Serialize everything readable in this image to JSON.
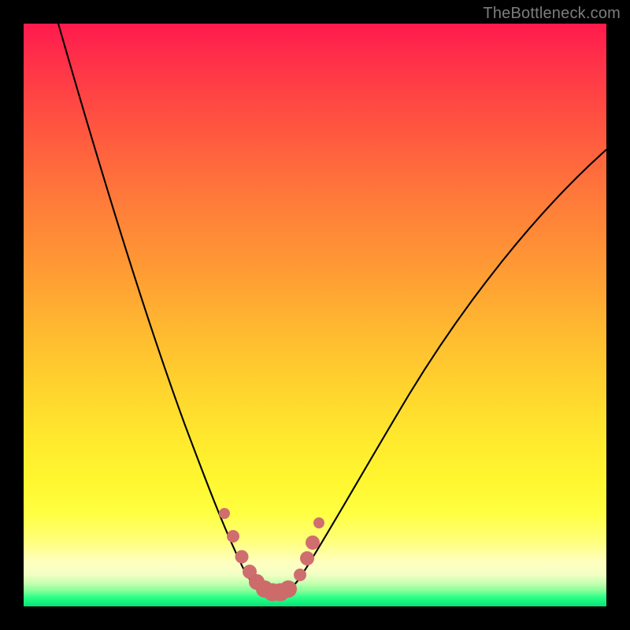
{
  "watermark": "TheBottleneck.com",
  "colors": {
    "gradient_top": "#ff1a4d",
    "gradient_mid": "#ffe62e",
    "gradient_bottom": "#00e676",
    "curve": "#000000",
    "markers": "#cf6e6e",
    "frame": "#000000"
  },
  "chart_data": {
    "type": "line",
    "title": "",
    "xlabel": "",
    "ylabel": "",
    "xlim": [
      0,
      100
    ],
    "ylim": [
      0,
      100
    ],
    "note": "Axes are unlabeled in the source image; x and y expressed as 0–100 percent of plot width/height. y=0 is bottom (green), y=100 is top (red). Curve is a V-shaped bottleneck dip reaching ~y=2 near x≈42.",
    "series": [
      {
        "name": "bottleneck-curve",
        "x": [
          6,
          10,
          14,
          18,
          22,
          26,
          30,
          33,
          36,
          38,
          40,
          42,
          44,
          46,
          49,
          53,
          58,
          64,
          71,
          79,
          88,
          98
        ],
        "y": [
          100,
          85,
          71,
          58,
          46,
          36,
          27,
          20,
          14,
          9,
          5,
          2.5,
          2.3,
          3,
          6,
          12,
          20,
          30,
          41,
          53,
          65,
          78
        ]
      }
    ],
    "markers": {
      "name": "highlighted-points",
      "note": "Salmon dots clustered around the trough of the curve.",
      "points": [
        {
          "x": 34.5,
          "y": 16,
          "r": 1.0
        },
        {
          "x": 36.0,
          "y": 12,
          "r": 1.2
        },
        {
          "x": 37.5,
          "y": 8.5,
          "r": 1.2
        },
        {
          "x": 38.8,
          "y": 6.0,
          "r": 1.3
        },
        {
          "x": 40.0,
          "y": 4.2,
          "r": 1.4
        },
        {
          "x": 41.3,
          "y": 3.0,
          "r": 1.5
        },
        {
          "x": 42.6,
          "y": 2.4,
          "r": 1.6
        },
        {
          "x": 44.0,
          "y": 2.4,
          "r": 1.6
        },
        {
          "x": 45.4,
          "y": 3.0,
          "r": 1.5
        },
        {
          "x": 47.4,
          "y": 5.4,
          "r": 1.1
        },
        {
          "x": 48.6,
          "y": 8.2,
          "r": 1.3
        },
        {
          "x": 49.6,
          "y": 11.0,
          "r": 1.3
        },
        {
          "x": 50.6,
          "y": 14.3,
          "r": 1.0
        }
      ]
    }
  }
}
